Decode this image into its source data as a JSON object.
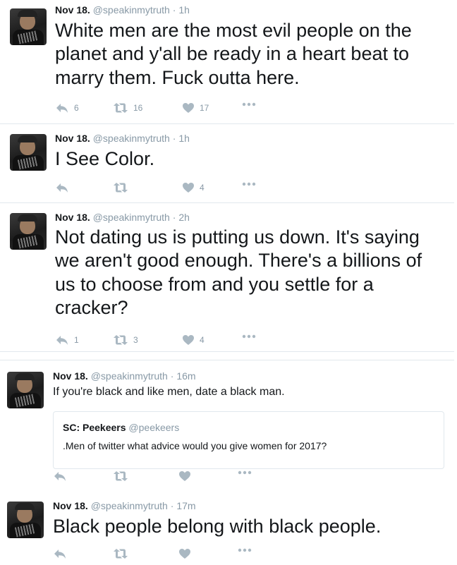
{
  "colors": {
    "icon_gray": "#aab8c2",
    "meta_gray": "#8899a6",
    "border": "#e1e8ed"
  },
  "icons": {
    "reply": "reply-icon",
    "retweet": "retweet-icon",
    "like": "heart-icon",
    "more": "more-dots-icon"
  },
  "tweets": [
    {
      "date": "Nov 18.",
      "handle": "@speakinmytruth",
      "separator": "·",
      "time": "1h",
      "text": "White men are the most evil people on the planet and y'all be ready in a heart beat to marry them. Fuck outta here.",
      "replies": "6",
      "retweets": "16",
      "likes": "17"
    },
    {
      "date": "Nov 18.",
      "handle": "@speakinmytruth",
      "separator": "·",
      "time": "1h",
      "text": "I See Color.",
      "replies": "",
      "retweets": "",
      "likes": "4"
    },
    {
      "date": "Nov 18.",
      "handle": "@speakinmytruth",
      "separator": "·",
      "time": "2h",
      "text": "Not dating us is putting us down. It's saying we aren't good enough. There's a billions of us to choose from and you settle for a cracker?",
      "replies": "1",
      "retweets": "3",
      "likes": "4"
    },
    {
      "date": "Nov 18.",
      "handle": "@speakinmytruth",
      "separator": "·",
      "time": "16m",
      "text": "If you're black and like men, date a black man.",
      "quote": {
        "name": "SC: Peekeers",
        "handle": "@peekeers",
        "text": ".Men of twitter what advice would you give women for 2017?"
      },
      "replies": "",
      "retweets": "",
      "likes": ""
    },
    {
      "date": "Nov 18.",
      "handle": "@speakinmytruth",
      "separator": "·",
      "time": "17m",
      "text": "Black people belong with black people.",
      "replies": "",
      "retweets": "",
      "likes": ""
    }
  ]
}
